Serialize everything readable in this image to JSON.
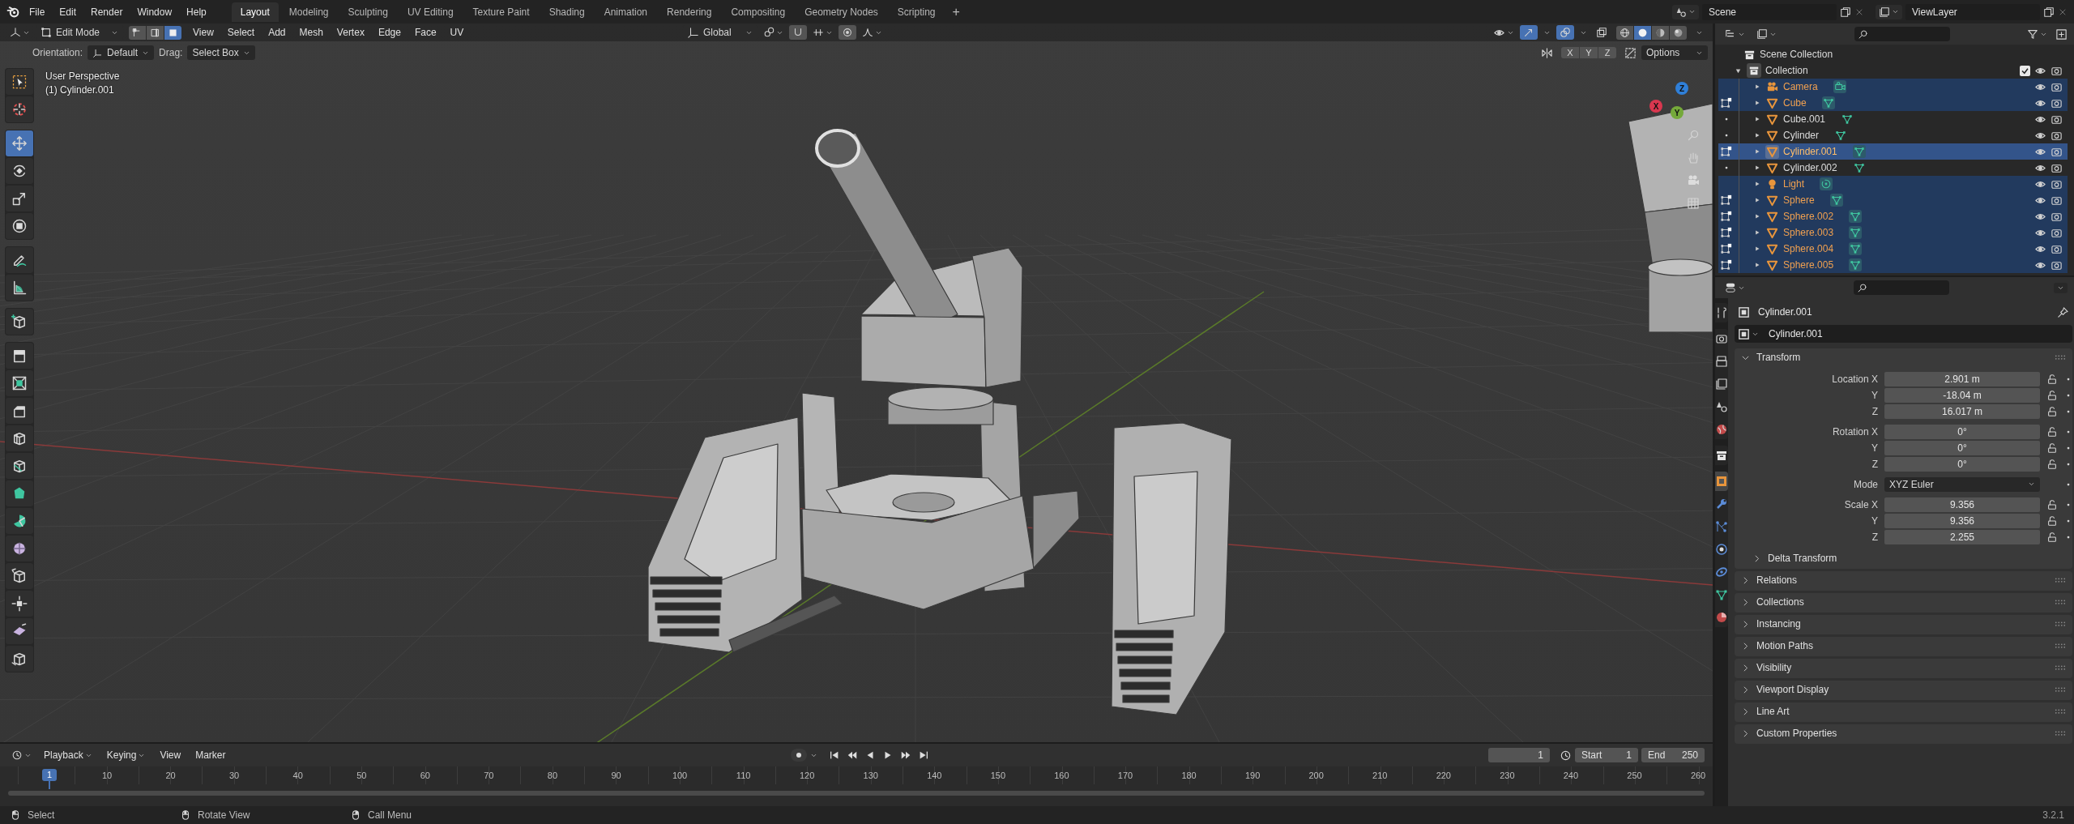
{
  "topbar": {
    "menus": [
      "File",
      "Edit",
      "Render",
      "Window",
      "Help"
    ],
    "workspaces": [
      {
        "label": "Layout",
        "selected": true
      },
      {
        "label": "Modeling",
        "selected": false
      },
      {
        "label": "Sculpting",
        "selected": false
      },
      {
        "label": "UV Editing",
        "selected": false
      },
      {
        "label": "Texture Paint",
        "selected": false
      },
      {
        "label": "Shading",
        "selected": false
      },
      {
        "label": "Animation",
        "selected": false
      },
      {
        "label": "Rendering",
        "selected": false
      },
      {
        "label": "Compositing",
        "selected": false
      },
      {
        "label": "Geometry Nodes",
        "selected": false
      },
      {
        "label": "Scripting",
        "selected": false
      }
    ],
    "add_workspace": "+",
    "scene": "Scene",
    "view_layer": "ViewLayer"
  },
  "viewport": {
    "mode": "Edit Mode",
    "select_modes": [
      {
        "kind": "vertex",
        "selected": false
      },
      {
        "kind": "edge",
        "selected": false
      },
      {
        "kind": "face",
        "selected": true
      }
    ],
    "menus": [
      "View",
      "Select",
      "Add",
      "Mesh",
      "Vertex",
      "Edge",
      "Face",
      "UV"
    ],
    "orientation": "Global",
    "shading": [
      {
        "kind": "wireframe",
        "selected": false
      },
      {
        "kind": "solid",
        "selected": true
      },
      {
        "kind": "material",
        "selected": false
      },
      {
        "kind": "rendered",
        "selected": false
      }
    ],
    "tool_settings": {
      "orientation_label": "Orientation:",
      "orientation": "Default",
      "drag_label": "Drag:",
      "drag": "Select Box",
      "mirror_axes": [
        {
          "label": "X",
          "on": false
        },
        {
          "label": "Y",
          "on": false
        },
        {
          "label": "Z",
          "on": false
        }
      ],
      "options": "Options"
    },
    "info": [
      "User Perspective",
      "(1) Cylinder.001"
    ],
    "tool_groups": [
      [
        {
          "kind": "select_box",
          "selected": false
        },
        {
          "kind": "cursor",
          "selected": false
        }
      ],
      [
        {
          "kind": "move",
          "selected": true
        },
        {
          "kind": "rotate",
          "selected": false
        },
        {
          "kind": "scale",
          "selected": false
        },
        {
          "kind": "transform",
          "selected": false
        }
      ],
      [
        {
          "kind": "annotate",
          "selected": false
        },
        {
          "kind": "measure",
          "selected": false
        }
      ],
      [
        {
          "kind": "add_cube",
          "selected": false
        }
      ],
      [
        {
          "kind": "extrude",
          "selected": false
        },
        {
          "kind": "inset",
          "selected": false
        },
        {
          "kind": "bevel",
          "selected": false
        },
        {
          "kind": "loop_cut",
          "selected": false
        },
        {
          "kind": "knife",
          "selected": false
        },
        {
          "kind": "poly_build",
          "selected": false
        },
        {
          "kind": "spin",
          "selected": false
        },
        {
          "kind": "smooth",
          "selected": false
        },
        {
          "kind": "edge_slide",
          "selected": false
        },
        {
          "kind": "shrink_fatten",
          "selected": false
        },
        {
          "kind": "shear",
          "selected": false
        },
        {
          "kind": "rip",
          "selected": false
        }
      ]
    ],
    "gizmo_axes": [
      {
        "label": "Z",
        "color": "#2f7fd8"
      },
      {
        "label": "Y",
        "color": "#75a93a"
      },
      {
        "label": "X",
        "color": "#d9374f"
      }
    ]
  },
  "outliner": {
    "root": "Scene Collection",
    "collection": {
      "name": "Collection",
      "expanded": true,
      "checked": true,
      "children": [
        {
          "name": "Camera",
          "kind": "camera",
          "selected": true,
          "active": false
        },
        {
          "name": "Cube",
          "kind": "mesh",
          "selected": true,
          "active": false,
          "edit_mode": true
        },
        {
          "name": "Cube.001",
          "kind": "mesh",
          "selected": false,
          "active": false,
          "edit_mode": false
        },
        {
          "name": "Cylinder",
          "kind": "mesh",
          "selected": false,
          "active": false,
          "edit_mode": false
        },
        {
          "name": "Cylinder.001",
          "kind": "mesh",
          "selected": true,
          "active": true,
          "edit_mode": true
        },
        {
          "name": "Cylinder.002",
          "kind": "mesh",
          "selected": false,
          "active": false,
          "edit_mode": false
        },
        {
          "name": "Light",
          "kind": "light",
          "selected": true,
          "active": false
        },
        {
          "name": "Sphere",
          "kind": "mesh",
          "selected": true,
          "active": false,
          "edit_mode": true
        },
        {
          "name": "Sphere.002",
          "kind": "mesh",
          "selected": true,
          "active": false,
          "edit_mode": true
        },
        {
          "name": "Sphere.003",
          "kind": "mesh",
          "selected": true,
          "active": false,
          "edit_mode": true
        },
        {
          "name": "Sphere.004",
          "kind": "mesh",
          "selected": true,
          "active": false,
          "edit_mode": true
        },
        {
          "name": "Sphere.005",
          "kind": "mesh",
          "selected": true,
          "active": false,
          "edit_mode": true
        }
      ]
    }
  },
  "properties": {
    "tab_groups": [
      [
        {
          "kind": "tool",
          "selected": false
        }
      ],
      [
        {
          "kind": "render",
          "selected": false
        },
        {
          "kind": "output",
          "selected": false
        },
        {
          "kind": "view_layer",
          "selected": false
        },
        {
          "kind": "scene",
          "selected": false
        },
        {
          "kind": "world",
          "selected": false
        }
      ],
      [
        {
          "kind": "collection",
          "selected": false
        }
      ],
      [
        {
          "kind": "object",
          "selected": true
        },
        {
          "kind": "modifiers",
          "selected": false
        },
        {
          "kind": "particles",
          "selected": false
        },
        {
          "kind": "physics",
          "selected": false
        },
        {
          "kind": "constraints",
          "selected": false
        },
        {
          "kind": "data",
          "selected": false
        },
        {
          "kind": "material",
          "selected": false
        }
      ]
    ],
    "object_name": "Cylinder.001",
    "name_field": "Cylinder.001",
    "transform": {
      "title": "Transform",
      "expanded": true,
      "groups": [
        [
          {
            "kind": "number",
            "label": "Location X",
            "value": "2.901 m"
          },
          {
            "kind": "number",
            "label": "Y",
            "value": "-18.04 m"
          },
          {
            "kind": "number",
            "label": "Z",
            "value": "16.017 m"
          }
        ],
        [
          {
            "kind": "number",
            "label": "Rotation X",
            "value": "0°"
          },
          {
            "kind": "number",
            "label": "Y",
            "value": "0°"
          },
          {
            "kind": "number",
            "label": "Z",
            "value": "0°"
          }
        ],
        [
          {
            "kind": "dropdown",
            "label": "Mode",
            "value": "XYZ Euler"
          }
        ],
        [
          {
            "kind": "number",
            "label": "Scale X",
            "value": "9.356"
          },
          {
            "kind": "number",
            "label": "Y",
            "value": "9.356"
          },
          {
            "kind": "number",
            "label": "Z",
            "value": "2.255"
          }
        ]
      ],
      "subpanel": {
        "title": "Delta Transform",
        "expanded": false
      }
    },
    "panels": [
      {
        "title": "Relations",
        "expanded": false
      },
      {
        "title": "Collections",
        "expanded": false
      },
      {
        "title": "Instancing",
        "expanded": false
      },
      {
        "title": "Motion Paths",
        "expanded": false
      },
      {
        "title": "Visibility",
        "expanded": false
      },
      {
        "title": "Viewport Display",
        "expanded": false
      },
      {
        "title": "Line Art",
        "expanded": false
      },
      {
        "title": "Custom Properties",
        "expanded": false
      }
    ]
  },
  "timeline": {
    "menus": [
      {
        "label": "Playback",
        "kind": "dropdown"
      },
      {
        "label": "Keying",
        "kind": "dropdown"
      },
      {
        "label": "View",
        "kind": "menu"
      },
      {
        "label": "Marker",
        "kind": "menu"
      }
    ],
    "frame": "1",
    "start_label": "Start",
    "start": "1",
    "end_label": "End",
    "end": "250",
    "playhead": "1",
    "ruler": [
      "10",
      "20",
      "30",
      "40",
      "50",
      "60",
      "70",
      "80",
      "90",
      "100",
      "110",
      "120",
      "130",
      "140",
      "150",
      "160",
      "170",
      "180",
      "190",
      "200",
      "210",
      "220",
      "230",
      "240",
      "250",
      "260"
    ]
  },
  "status_bar": {
    "hints": [
      {
        "kind": "left",
        "label": "Select"
      },
      {
        "kind": "middle",
        "label": "Rotate View"
      },
      {
        "kind": "right",
        "label": "Call Menu"
      }
    ],
    "version": "3.2.1"
  }
}
